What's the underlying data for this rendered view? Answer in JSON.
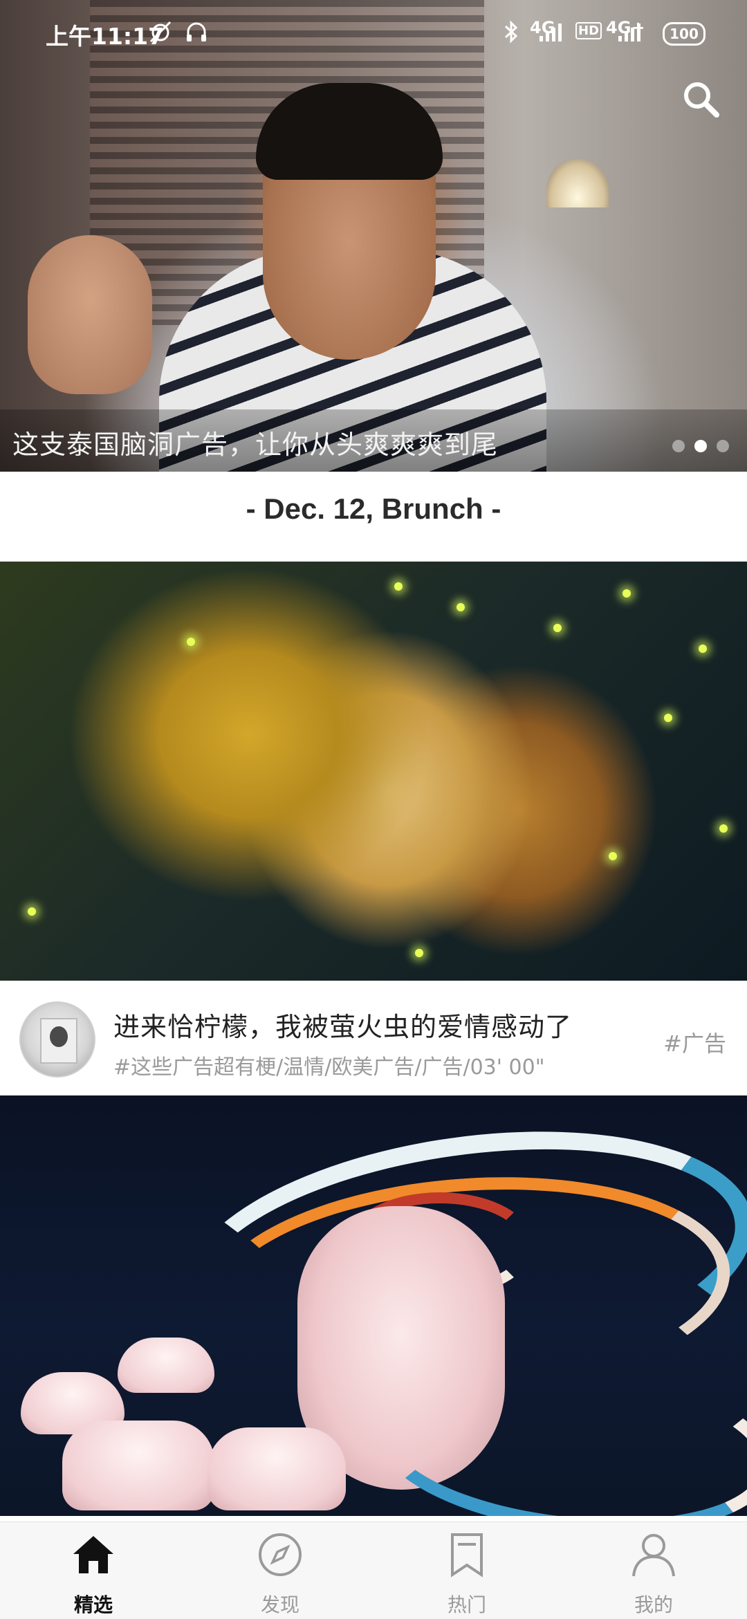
{
  "status_bar": {
    "time": "上午11:17",
    "signal1": "4G",
    "hd": "HD",
    "signal2": "4G+",
    "battery": "100"
  },
  "hero": {
    "caption": "这支泰国脑洞广告，让你从头爽爽爽到尾",
    "page_dots": 3,
    "active_dot": 2
  },
  "section": {
    "date_heading": "- Dec. 12, Brunch -"
  },
  "card1": {
    "title": "进来恰柠檬，我被萤火虫的爱情感动了",
    "meta": "#这些广告超有梗/温情/欧美广告/广告/03' 00\"",
    "tag": "#广告"
  },
  "tabbar": {
    "items": [
      {
        "label": "精选",
        "icon": "home-icon",
        "active": true
      },
      {
        "label": "发现",
        "icon": "compass-icon",
        "active": false
      },
      {
        "label": "热门",
        "icon": "bookmark-icon",
        "active": false
      },
      {
        "label": "我的",
        "icon": "user-icon",
        "active": false
      }
    ]
  },
  "colors": {
    "active_tab": "#111111",
    "inactive_tab": "#9a9a9a",
    "meta_text": "#9a9a9a"
  }
}
